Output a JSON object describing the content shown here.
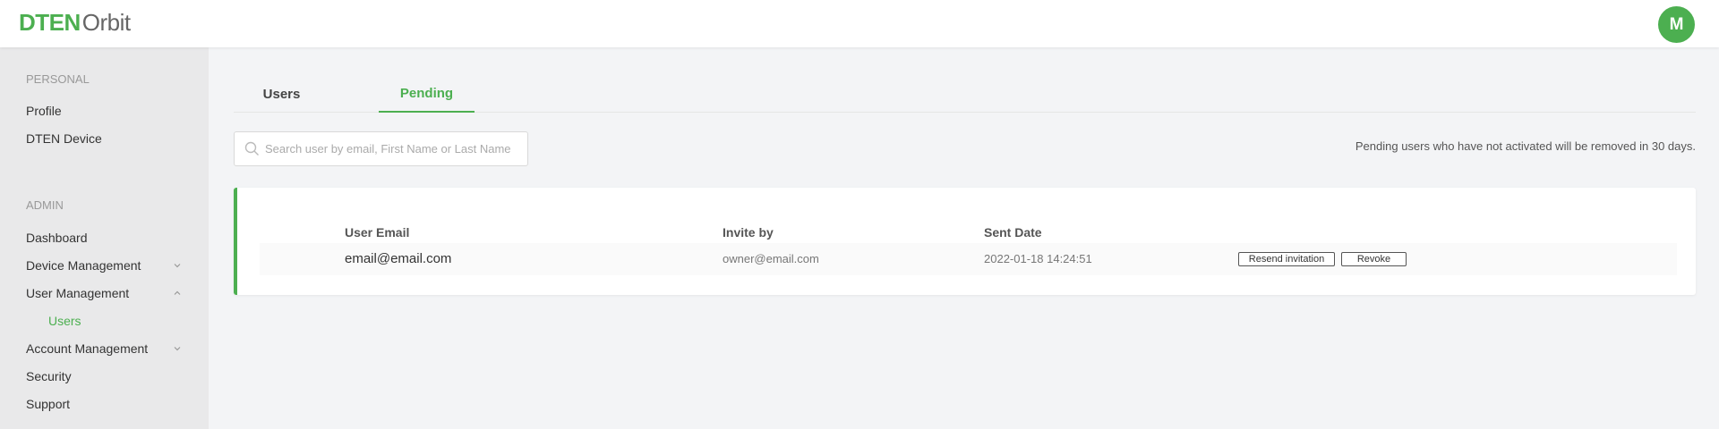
{
  "header": {
    "logo_brand": "DTEN",
    "logo_product": "Orbit",
    "avatar_initial": "M"
  },
  "sidebar": {
    "personal_title": "PERSONAL",
    "personal_items": [
      "Profile",
      "DTEN Device"
    ],
    "admin_title": "ADMIN",
    "admin_items": {
      "dashboard": "Dashboard",
      "device_management": "Device Management",
      "user_management": "User Management",
      "users": "Users",
      "account_management": "Account Management",
      "security": "Security",
      "support": "Support"
    }
  },
  "tabs": [
    {
      "label": "Users",
      "active": false
    },
    {
      "label": "Pending",
      "active": true
    }
  ],
  "search": {
    "placeholder": "Search user by email, First Name or Last Name",
    "value": ""
  },
  "notice": "Pending users who have not activated will be removed in 30 days.",
  "table": {
    "headers": {
      "email": "User Email",
      "invite_by": "Invite by",
      "sent_date": "Sent Date"
    },
    "rows": [
      {
        "email": "email@email.com",
        "invite_by": "owner@email.com",
        "sent_date": "2022-01-18 14:24:51",
        "resend_label": "Resend invitation",
        "revoke_label": "Revoke"
      }
    ]
  },
  "colors": {
    "accent": "#4caf50",
    "sidebar_bg": "#e9e9ea",
    "page_bg": "#f3f4f6"
  },
  "icons": {
    "search": "search-icon",
    "expand": "chevron-down-icon",
    "collapse": "chevron-up-icon"
  }
}
